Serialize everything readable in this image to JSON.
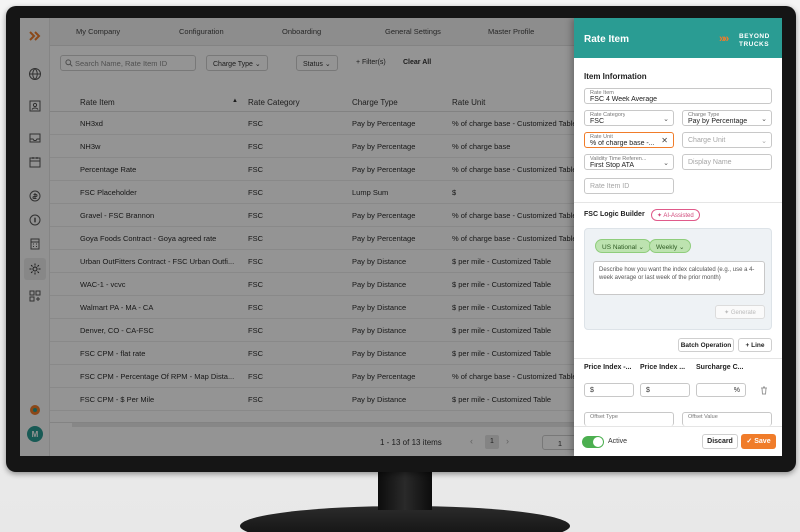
{
  "top_nav": [
    "My Company",
    "Configuration",
    "Onboarding",
    "General Settings",
    "Master Profile"
  ],
  "filters": {
    "search_placeholder": "Search Name, Rate Item ID",
    "charge_type": "Charge Type",
    "status": "Status",
    "add_filter": "+ Filter(s)",
    "clear_all": "Clear All"
  },
  "table": {
    "headers": [
      "Rate Item",
      "Rate Category",
      "Charge Type",
      "Rate Unit"
    ],
    "rows": [
      [
        "NH3xd",
        "FSC",
        "Pay by Percentage",
        "% of charge base - Customized Table"
      ],
      [
        "NH3w",
        "FSC",
        "Pay by Percentage",
        "% of charge base"
      ],
      [
        "Percentage Rate",
        "FSC",
        "Pay by Percentage",
        "% of charge base - Customized Table"
      ],
      [
        "FSC Placeholder",
        "FSC",
        "Lump Sum",
        "$"
      ],
      [
        "Gravel - FSC Brannon",
        "FSC",
        "Pay by Percentage",
        "% of charge base - Customized Table"
      ],
      [
        "Goya Foods Contract - Goya agreed rate",
        "FSC",
        "Pay by Percentage",
        "% of charge base - Customized Table"
      ],
      [
        "Urban OutFitters Contract - FSC Urban Outfi...",
        "FSC",
        "Pay by Distance",
        "$ per mile - Customized Table"
      ],
      [
        "WAC-1 - vcvc",
        "FSC",
        "Pay by Distance",
        "$ per mile - Customized Table"
      ],
      [
        "Walmart PA - MA - CA",
        "FSC",
        "Pay by Distance",
        "$ per mile - Customized Table"
      ],
      [
        "Denver, CO - CA-FSC",
        "FSC",
        "Pay by Distance",
        "$ per mile - Customized Table"
      ],
      [
        "FSC CPM - flat rate",
        "FSC",
        "Pay by Distance",
        "$ per mile - Customized Table"
      ],
      [
        "FSC CPM - Percentage Of RPM - Map Dista...",
        "FSC",
        "Pay by Percentage",
        "% of charge base - Customized Table"
      ],
      [
        "FSC CPM - $ Per Mile",
        "FSC",
        "Pay by Distance",
        "$ per mile - Customized Table"
      ]
    ]
  },
  "pagination": {
    "summary": "1 - 13 of 13 items",
    "current_page": "1",
    "prev": "‹",
    "next": "›",
    "page_box": "1"
  },
  "user_avatar": "M",
  "panel": {
    "title": "Rate Item",
    "logo_line1": "BEYOND",
    "logo_line2": "TRUCKS",
    "section_title": "Item Information",
    "fields": {
      "rate_item": {
        "label": "Rate Item",
        "value": "FSC 4 Week Average"
      },
      "rate_category": {
        "label": "Rate Category",
        "value": "FSC"
      },
      "charge_type": {
        "label": "Charge Type",
        "value": "Pay by Percentage"
      },
      "rate_unit": {
        "label": "Rate Unit",
        "value": "% of charge base -..."
      },
      "charge_unit": {
        "placeholder": "Charge Unit"
      },
      "validity_time": {
        "label": "Validity Time Referen...",
        "value": "First Stop ATA"
      },
      "display_name": {
        "placeholder": "Display Name"
      },
      "rate_item_id": {
        "placeholder": "Rate Item ID"
      }
    },
    "logic_builder_title": "FSC Logic Builder",
    "ai_badge": "AI-Assisted",
    "tags": [
      "US National",
      "Weekly"
    ],
    "description_placeholder": "Describe how you want the index calculated (e.g., use a 4-week average or last week of the prior month)",
    "generate_label": "Generate",
    "batch_operation": "Batch Operation",
    "add_line": "+ Line",
    "table_headers": [
      "Price Index -...",
      "Price Index ...",
      "Surcharge C..."
    ],
    "inputs": [
      "$",
      "$",
      "%"
    ],
    "offset_type": "Offset Type",
    "offset_value": "Offset Value",
    "active_label": "Active",
    "discard": "Discard",
    "save": "Save",
    "accent_color": "#f07c2a",
    "header_color": "#2a9c93"
  }
}
